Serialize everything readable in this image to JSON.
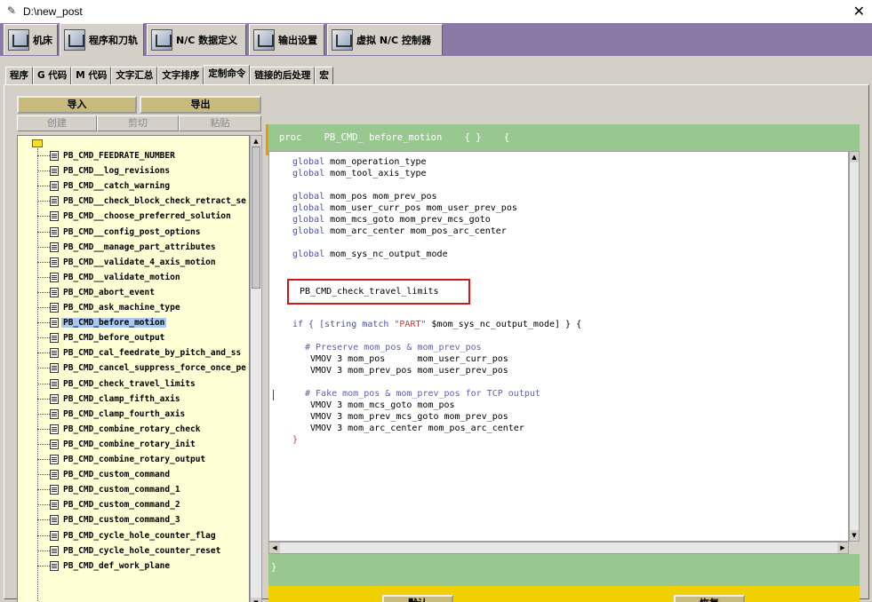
{
  "window": {
    "title": "D:\\new_post",
    "close_glyph": "✕"
  },
  "main_tabs": [
    "机床",
    "程序和刀轨",
    "N/C 数据定义",
    "输出设置",
    "虚拟 N/C 控制器"
  ],
  "sub_tabs": [
    "程序",
    "G 代码",
    "M 代码",
    "文字汇总",
    "文字排序",
    "定制命令",
    "链接的后处理",
    "宏"
  ],
  "buttons": {
    "import": "导入",
    "export": "导出",
    "create": "创建",
    "cut": "剪切",
    "paste": "粘贴",
    "default": "默认",
    "restore": "恢复"
  },
  "tree_items": [
    "PB_CMD_FEEDRATE_NUMBER",
    "PB_CMD__log_revisions",
    "PB_CMD__catch_warning",
    "PB_CMD__check_block_check_retract_se",
    "PB_CMD__choose_preferred_solution",
    "PB_CMD__config_post_options",
    "PB_CMD__manage_part_attributes",
    "PB_CMD__validate_4_axis_motion",
    "PB_CMD__validate_motion",
    "PB_CMD_abort_event",
    "PB_CMD_ask_machine_type",
    "PB_CMD_before_motion",
    "PB_CMD_before_output",
    "PB_CMD_cal_feedrate_by_pitch_and_ss",
    "PB_CMD_cancel_suppress_force_once_pe",
    "PB_CMD_check_travel_limits",
    "PB_CMD_clamp_fifth_axis",
    "PB_CMD_clamp_fourth_axis",
    "PB_CMD_combine_rotary_check",
    "PB_CMD_combine_rotary_init",
    "PB_CMD_combine_rotary_output",
    "PB_CMD_custom_command",
    "PB_CMD_custom_command_1",
    "PB_CMD_custom_command_2",
    "PB_CMD_custom_command_3",
    "PB_CMD_cycle_hole_counter_flag",
    "PB_CMD_cycle_hole_counter_reset",
    "PB_CMD_def_work_plane"
  ],
  "selected_item": "PB_CMD_before_motion",
  "proc_header": "proc    PB_CMD_ before_motion    { }    {",
  "code": {
    "l1_kw": "global",
    "l1": " mom_operation_type",
    "l2_kw": "global",
    "l2": " mom_tool_axis_type",
    "l3_kw": "global",
    "l3": " mom_pos mom_prev_pos",
    "l4_kw": "global",
    "l4": " mom_user_curr_pos mom_user_prev_pos",
    "l5_kw": "global",
    "l5": " mom_mcs_goto mom_prev_mcs_goto",
    "l6_kw": "global",
    "l6": " mom_arc_center mom_pos_arc_center",
    "l7_kw": "global",
    "l7": " mom_sys_nc_output_mode",
    "l8": "PB_CMD_check_travel_limits",
    "l9a": "if { [string match ",
    "l9b": "\"PART\"",
    "l9c": " $mom_sys_nc_output_mode] } {",
    "l10": "# Preserve mom_pos & mom_prev_pos",
    "l11": "VMOV 3 mom_pos      mom_user_curr_pos",
    "l12": "VMOV 3 mom_prev_pos mom_user_prev_pos",
    "l13": "# Fake mom_pos & mom_prev_pos for TCP output",
    "l14": "VMOV 3 mom_mcs_goto mom_pos",
    "l15": "VMOV 3 mom_prev_mcs_goto mom_prev_pos",
    "l16": "VMOV 3 mom_arc_center mom_pos_arc_center",
    "l17": "}"
  },
  "proc_end": "}",
  "colors": {
    "keyword": "#4a50a8",
    "string": "#c04040",
    "comment": "#6060b0",
    "proc_bar": "#98c890",
    "footer": "#f0d000",
    "tab_strip": "#8a79a5",
    "highlight_box": "#d01818"
  }
}
